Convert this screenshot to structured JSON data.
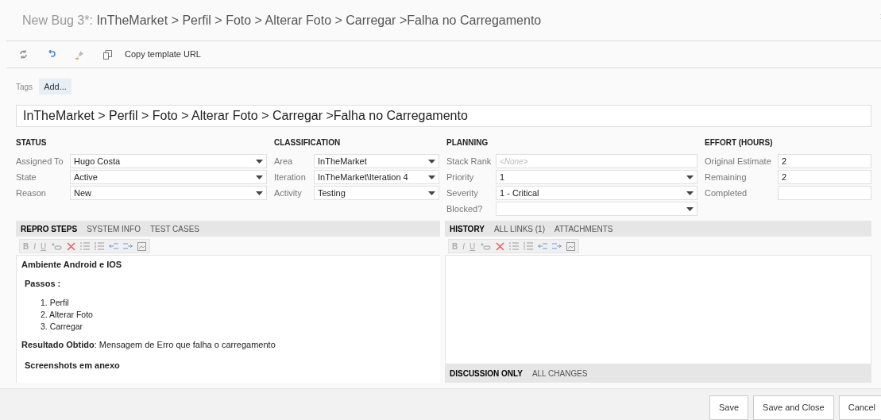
{
  "window": {
    "title_prefix": "New Bug 3*:",
    "title": "InTheMarket > Perfil > Foto > Alterar Foto > Carregar >Falha no Carregamento"
  },
  "toolbar": {
    "copy_label": "Copy template URL"
  },
  "tags": {
    "label": "Tags",
    "add": "Add..."
  },
  "title_field": {
    "value": "InTheMarket > Perfil > Foto > Alterar Foto > Carregar >Falha no Carregamento"
  },
  "sections": [
    {
      "heading": "STATUS",
      "fields": [
        {
          "label": "Assigned To",
          "value": "Hugo Costa",
          "kind": "dropdown"
        },
        {
          "label": "State",
          "value": "Active",
          "kind": "dropdown"
        },
        {
          "label": "Reason",
          "value": "New",
          "kind": "dropdown"
        }
      ]
    },
    {
      "heading": "CLASSIFICATION",
      "fields": [
        {
          "label": "Area",
          "value": "InTheMarket",
          "kind": "dropdown"
        },
        {
          "label": "Iteration",
          "value": "InTheMarket\\Iteration 4",
          "kind": "dropdown"
        },
        {
          "label": "Activity",
          "value": "Testing",
          "kind": "dropdown"
        }
      ]
    },
    {
      "heading": "PLANNING",
      "fields": [
        {
          "label": "Stack Rank",
          "placeholder": "<None>",
          "kind": "text"
        },
        {
          "label": "Priority",
          "value": "1",
          "kind": "dropdown"
        },
        {
          "label": "Severity",
          "value": "1 - Critical",
          "kind": "dropdown"
        },
        {
          "label": "Blocked?",
          "kind": "dropdown"
        }
      ]
    },
    {
      "heading": "EFFORT (HOURS)",
      "fields": [
        {
          "label": "Original Estimate",
          "value": "2",
          "kind": "text"
        },
        {
          "label": "Remaining",
          "value": "2",
          "kind": "text"
        },
        {
          "label": "Completed",
          "kind": "text"
        }
      ]
    }
  ],
  "left_panel": {
    "tabs": [
      {
        "label": "REPRO STEPS",
        "selected": true
      },
      {
        "label": "SYSTEM INFO",
        "selected": false
      },
      {
        "label": "TEST CASES",
        "selected": false
      }
    ],
    "format_buttons": [
      "B",
      "I",
      "U"
    ],
    "content": [
      {
        "kind": "heading",
        "text": "Ambiente Android e IOS"
      },
      {
        "kind": "heading",
        "text": "Passos :"
      },
      {
        "kind": "list",
        "items": [
          "1. Perfil",
          "2. Alterar Foto",
          "3. Carregar"
        ]
      },
      {
        "kind": "paragraph",
        "text": "**Resultado Obtido**: Mensagem de Erro que falha o carregamento"
      },
      {
        "kind": "heading",
        "text": "Screenshots em anexo"
      }
    ]
  },
  "right_panel": {
    "tabs": [
      {
        "label": "HISTORY",
        "selected": true
      },
      {
        "label": "ALL LINKS (1)",
        "selected": false
      },
      {
        "label": "ATTACHMENTS",
        "selected": false
      }
    ],
    "format_buttons": [
      "B",
      "I",
      "U"
    ],
    "filters": [
      {
        "label": "DISCUSSION ONLY",
        "selected": true
      },
      {
        "label": "ALL CHANGES",
        "selected": false
      }
    ]
  },
  "buttons": [
    "Save",
    "Save and Close",
    "Cancel"
  ]
}
